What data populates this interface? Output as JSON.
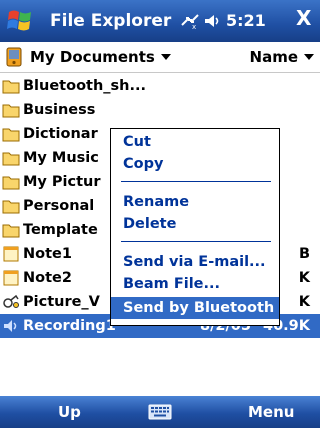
{
  "title_bar": {
    "app_title": "File Explorer",
    "time": "5:21",
    "close_label": "X",
    "icons": [
      "start-flag-icon",
      "connectivity-icon",
      "volume-icon"
    ]
  },
  "location_bar": {
    "folder": "My Documents",
    "sort": "Name"
  },
  "files": [
    {
      "name": "Bluetooth_sh...",
      "type": "folder",
      "date": "",
      "size": ""
    },
    {
      "name": "Business",
      "type": "folder",
      "date": "",
      "size": ""
    },
    {
      "name": "Dictionar",
      "type": "folder",
      "date": "",
      "size": ""
    },
    {
      "name": "My Music",
      "type": "folder",
      "date": "",
      "size": ""
    },
    {
      "name": "My Pictur",
      "type": "folder",
      "date": "",
      "size": ""
    },
    {
      "name": "Personal",
      "type": "folder",
      "date": "",
      "size": ""
    },
    {
      "name": "Template",
      "type": "folder",
      "date": "",
      "size": ""
    },
    {
      "name": "Note1",
      "type": "note",
      "date": "",
      "size": "B"
    },
    {
      "name": "Note2",
      "type": "note",
      "date": "",
      "size": "K"
    },
    {
      "name": "Picture_V",
      "type": "picture",
      "date": "",
      "size": "K"
    },
    {
      "name": "Recording1",
      "type": "recording",
      "date": "8/2/05",
      "size": "40.9K",
      "selected": true
    }
  ],
  "context_menu": {
    "items": [
      "Cut",
      "Copy",
      "Rename",
      "Delete",
      "Send via E-mail...",
      "Beam File...",
      "Send by Bluetooth"
    ],
    "highlighted": "Send by Bluetooth"
  },
  "soft_keys": {
    "left": "Up",
    "right": "Menu",
    "center_icon": "keyboard-icon"
  },
  "colors": {
    "title_blue": "#1f4fa3",
    "selection_blue": "#316ac5",
    "menu_text": "#003399"
  }
}
